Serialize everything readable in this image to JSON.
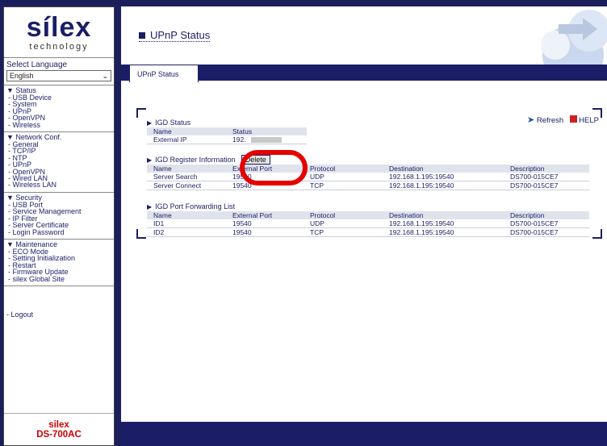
{
  "logo": {
    "main": "sílex",
    "sub": "technology"
  },
  "language": {
    "label": "Select Language",
    "value": "English"
  },
  "menu": [
    {
      "head": "▼ Status",
      "items": [
        "- USB Device",
        "- System",
        "- UPnP",
        "- OpenVPN",
        "- Wireless"
      ]
    },
    {
      "head": "▼ Network Conf.",
      "items": [
        "- General",
        "- TCP/IP",
        "- NTP",
        "- UPnP",
        "- OpenVPN",
        "- Wired LAN",
        "- Wireless LAN"
      ]
    },
    {
      "head": "▼ Security",
      "items": [
        "- USB Port",
        "- Service Management",
        "- IP Filter",
        "- Server Certificate",
        "- Login Password"
      ]
    },
    {
      "head": "▼ Maintenance",
      "items": [
        "- ECO Mode",
        "- Setting Initialization",
        "- Restart",
        "- Firmware Update",
        "- silex Global Site"
      ]
    }
  ],
  "logout": "- Logout",
  "model": {
    "brand": "silex",
    "name": "DS-700AC"
  },
  "page_title": "UPnP Status",
  "tab": "UPnP Status",
  "toolbar": {
    "refresh": "Refresh",
    "help": "HELP"
  },
  "igd_status": {
    "title": "IGD Status",
    "headers": [
      "Name",
      "Status"
    ],
    "rows": [
      [
        "External IP",
        "192."
      ]
    ]
  },
  "igd_register": {
    "title": "IGD Register Information",
    "delete_label": "Delete",
    "headers": [
      "Name",
      "External Port",
      "Protocol",
      "Destination",
      "Description"
    ],
    "rows": [
      [
        "Server Search",
        "19540",
        "UDP",
        "192.168.1.195:19540",
        "DS700-015CE7"
      ],
      [
        "Server Connect",
        "19540",
        "TCP",
        "192.168.1.195:19540",
        "DS700-015CE7"
      ]
    ]
  },
  "igd_forward": {
    "title": "IGD Port Forwarding List",
    "headers": [
      "Name",
      "External Port",
      "Protocol",
      "Destination",
      "Description"
    ],
    "rows": [
      [
        "ID1",
        "19540",
        "UDP",
        "192.168.1.195:19540",
        "DS700-015CE7"
      ],
      [
        "ID2",
        "19540",
        "TCP",
        "192.168.1.195:19540",
        "DS700-015CE7"
      ]
    ]
  }
}
